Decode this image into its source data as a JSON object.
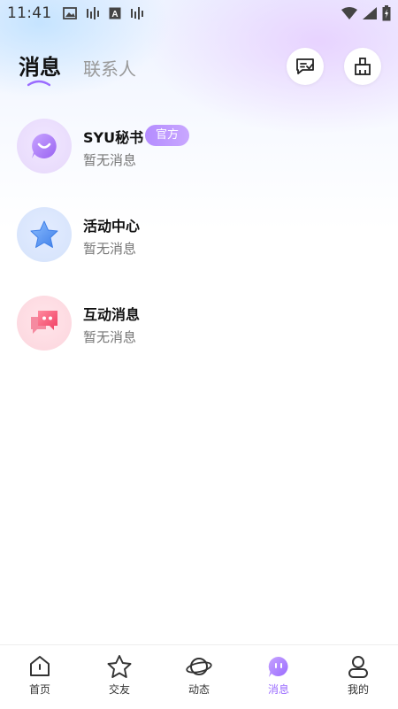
{
  "status_bar": {
    "time": "11:41",
    "icons": [
      "image-icon",
      "waveform-icon",
      "font-icon",
      "waveform-icon"
    ],
    "right_icons": [
      "wifi-icon",
      "signal-icon",
      "battery-icon"
    ]
  },
  "header": {
    "tabs": [
      {
        "label": "消息",
        "active": true
      },
      {
        "label": "联系人",
        "active": false
      }
    ],
    "actions": [
      "read-all-icon",
      "clean-icon"
    ]
  },
  "messages": [
    {
      "title": "SYU秘书",
      "badge": "官方",
      "subtitle": "暂无消息",
      "icon": "chat-bubble-icon",
      "color": "#b98cff"
    },
    {
      "title": "活动中心",
      "subtitle": "暂无消息",
      "icon": "star-icon",
      "color": "#4f8df5"
    },
    {
      "title": "互动消息",
      "subtitle": "暂无消息",
      "icon": "interaction-icon",
      "color": "#ff5c7a"
    }
  ],
  "bottom_nav": [
    {
      "label": "首页",
      "icon": "home-icon",
      "active": false
    },
    {
      "label": "交友",
      "icon": "star-outline-icon",
      "active": false
    },
    {
      "label": "动态",
      "icon": "planet-icon",
      "active": false
    },
    {
      "label": "消息",
      "icon": "message-icon",
      "active": true
    },
    {
      "label": "我的",
      "icon": "user-icon",
      "active": false
    }
  ],
  "colors": {
    "accent": "#9a6bff",
    "badge_start": "#b48cff",
    "badge_end": "#c9a8ff"
  }
}
